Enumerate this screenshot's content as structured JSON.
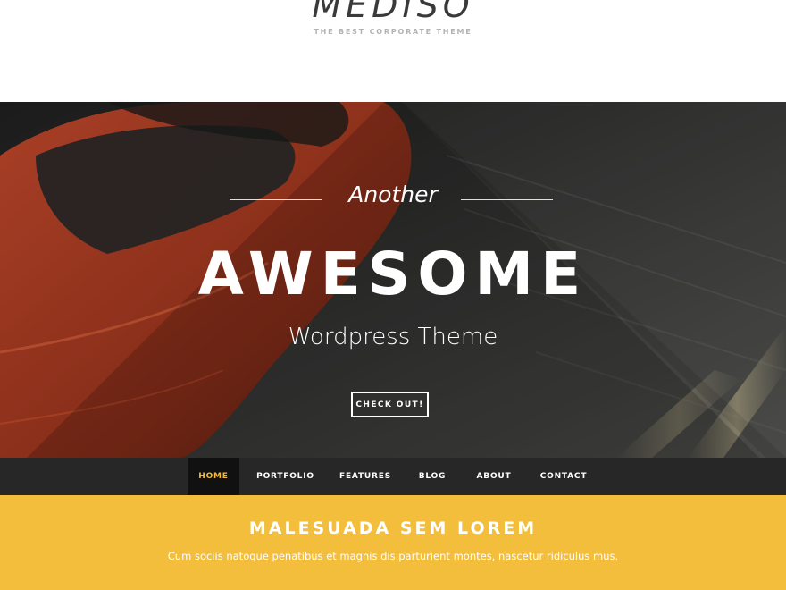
{
  "header": {
    "logo": "MEDISO",
    "tagline": "THE BEST CORPORATE THEME"
  },
  "hero": {
    "kicker": "Another",
    "headline": "AWESOME",
    "subheadline": "Wordpress Theme",
    "cta_label": "CHECK OUT!"
  },
  "nav": {
    "items": [
      {
        "label": "HOME",
        "active": true
      },
      {
        "label": "PORTFOLIO",
        "active": false
      },
      {
        "label": "FEATURES",
        "active": false
      },
      {
        "label": "BLOG",
        "active": false
      },
      {
        "label": "ABOUT",
        "active": false
      },
      {
        "label": "CONTACT",
        "active": false
      }
    ]
  },
  "promo": {
    "title": "MALESUADA SEM LOREM",
    "text": "Cum sociis natoque penatibus et magnis dis parturient montes, nascetur ridiculus mus."
  },
  "colors": {
    "accent": "#f2be3b",
    "nav_bg": "#272727",
    "nav_active_bg": "#111111",
    "nav_active_text": "#f2b93b"
  }
}
